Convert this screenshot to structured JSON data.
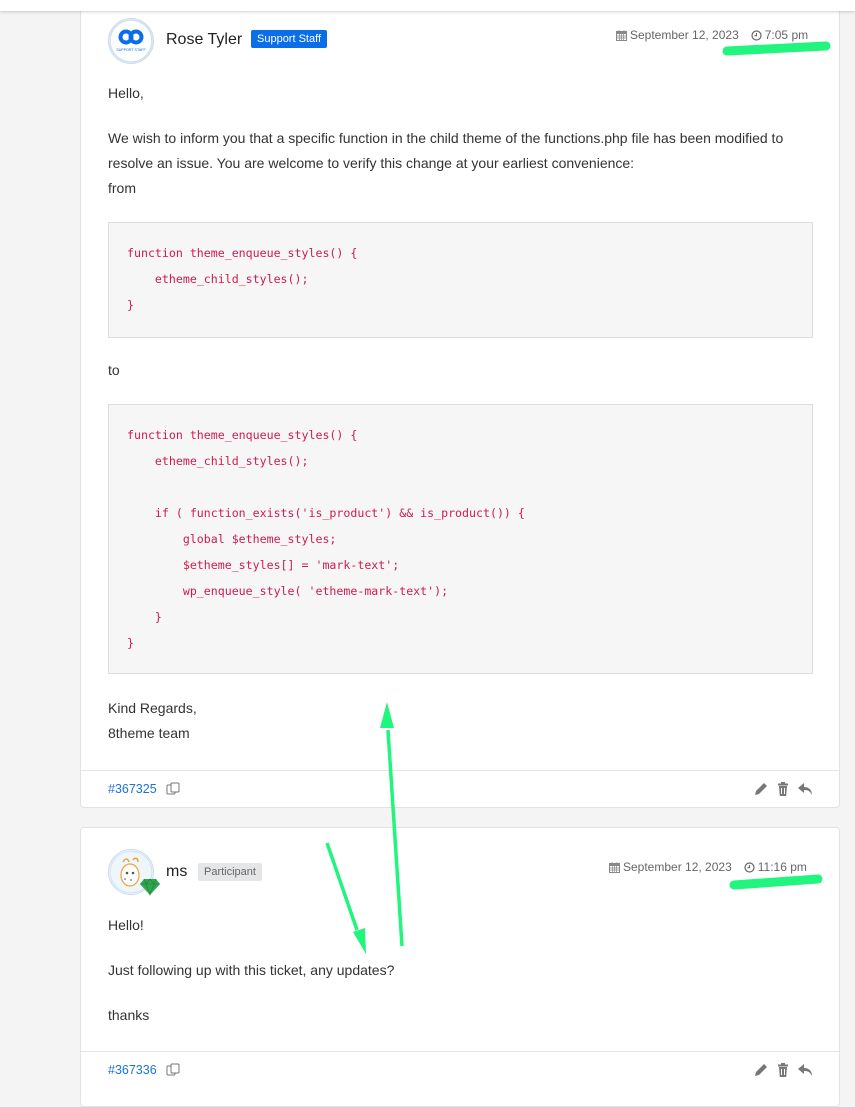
{
  "replies": [
    {
      "author": "Rose Tyler",
      "role_badge": "Support Staff",
      "avatar_label": "SUPPORT STAFF",
      "date": "September 12, 2023",
      "time": "7:05 pm",
      "greeting": "Hello,",
      "paragraph": "We wish to inform you that a specific function in the child theme of the functions.php file has been modified to resolve an issue. You are welcome to verify this change at your earliest convenience:",
      "from_label": "from",
      "code_before": [
        "function theme_enqueue_styles() {",
        "    etheme_child_styles();",
        "}"
      ],
      "to_label": "to",
      "code_after": [
        "function theme_enqueue_styles() {",
        "    etheme_child_styles();",
        "",
        "    if ( function_exists('is_product') && is_product()) {",
        "        global $etheme_styles;",
        "        $etheme_styles[] = 'mark-text';",
        "        wp_enqueue_style( 'etheme-mark-text');",
        "    }",
        "}"
      ],
      "signoff_1": "Kind Regards,",
      "signoff_2": "8theme team",
      "reply_id": "#367325",
      "actions": [
        "edit-icon",
        "trash-icon",
        "reply-icon"
      ]
    },
    {
      "author": "ms",
      "role_badge": "Participant",
      "date": "September 12, 2023",
      "time": "11:16 pm",
      "line_1": "Hello!",
      "line_2": "Just following up with this ticket, any updates?",
      "line_3": "thanks",
      "reply_id": "#367336",
      "actions": [
        "edit-icon",
        "trash-icon",
        "reply-icon"
      ]
    }
  ],
  "colors": {
    "accent_link": "#1a73d9",
    "staff_badge": "#0a6ee8",
    "code_text": "#d01b4e",
    "annotation_green": "#22f57e"
  }
}
